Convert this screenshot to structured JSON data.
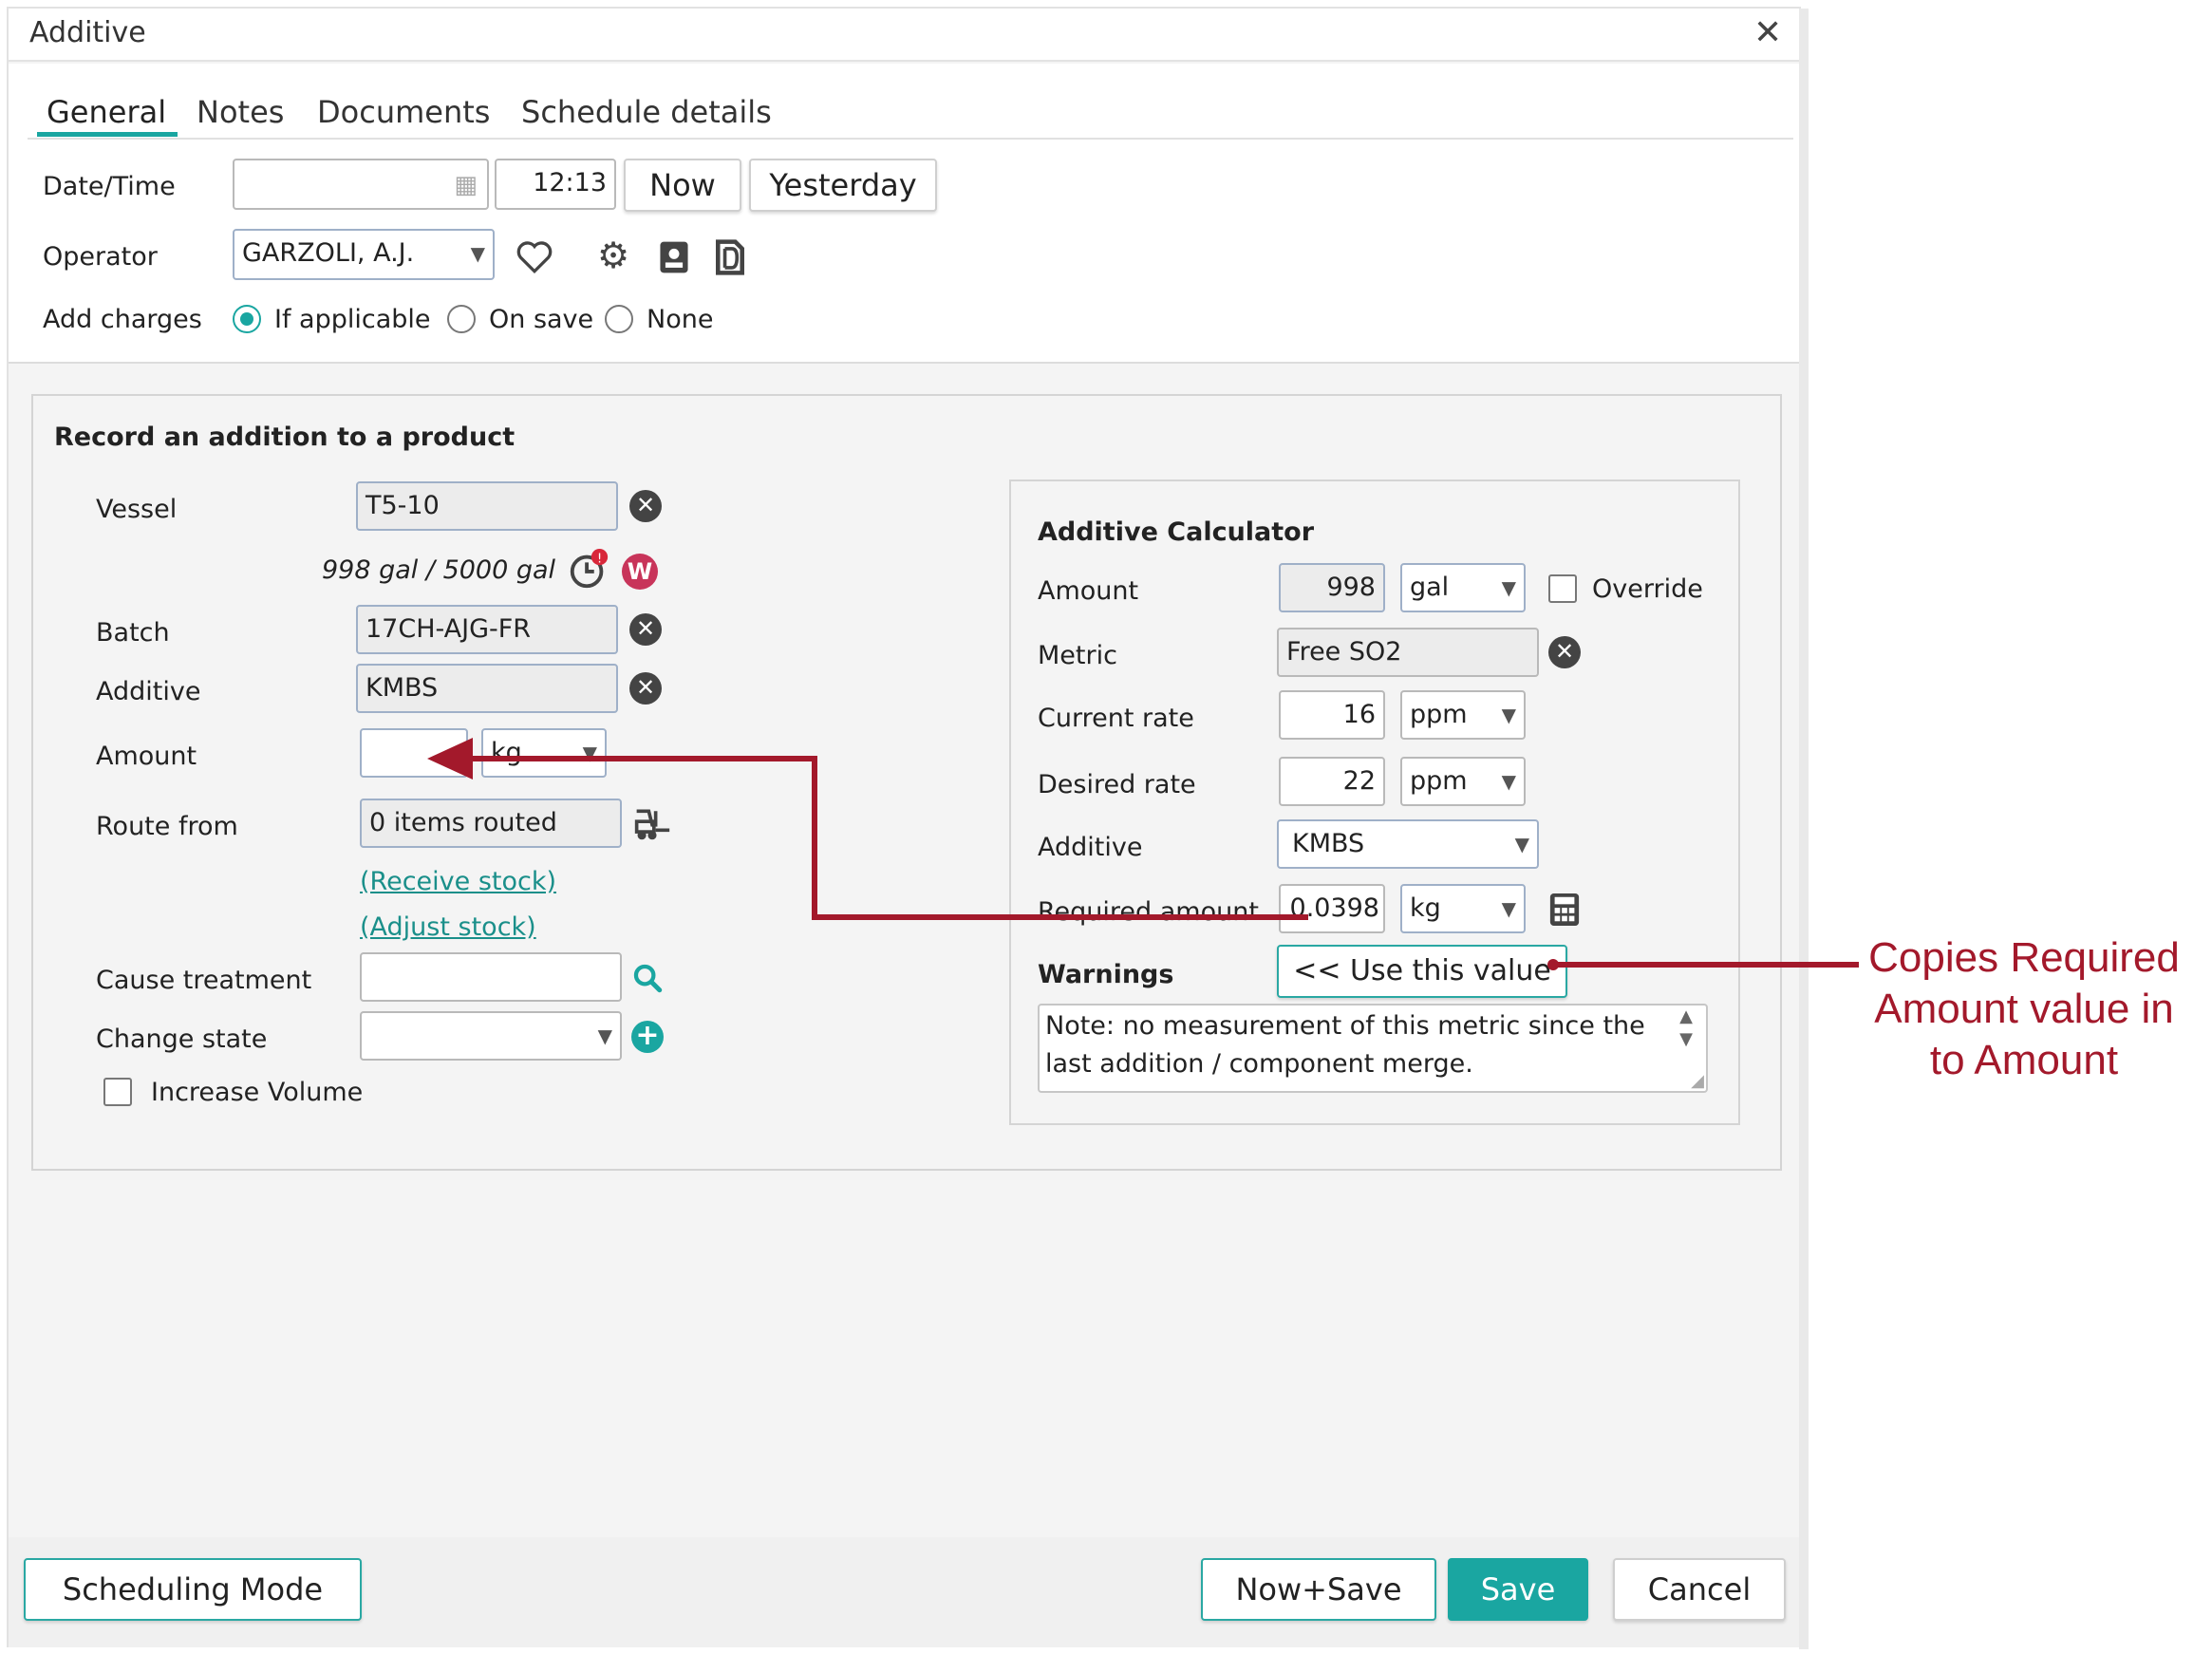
{
  "dialog": {
    "title": "Additive"
  },
  "tabs": [
    {
      "label": "General",
      "active": true
    },
    {
      "label": "Notes"
    },
    {
      "label": "Documents"
    },
    {
      "label": "Schedule details"
    }
  ],
  "datetime": {
    "label": "Date/Time",
    "date_value": "",
    "time_value": "12:13",
    "now_label": "Now",
    "yesterday_label": "Yesterday"
  },
  "operator": {
    "label": "Operator",
    "value": "GARZOLI, A.J."
  },
  "charges": {
    "label": "Add charges",
    "options": [
      "If applicable",
      "On save",
      "None"
    ],
    "selected": "If applicable"
  },
  "record": {
    "heading": "Record an addition to a product",
    "vessel": {
      "label": "Vessel",
      "value": "T5-10",
      "capacity_text": "998 gal / 5000 gal"
    },
    "batch": {
      "label": "Batch",
      "value": "17CH-AJG-FR"
    },
    "additive": {
      "label": "Additive",
      "value": "KMBS"
    },
    "amount": {
      "label": "Amount",
      "value": "",
      "unit": "kg"
    },
    "route": {
      "label": "Route from",
      "value": "0 items routed",
      "receive_link": "(Receive stock)",
      "adjust_link": "(Adjust stock)"
    },
    "cause": {
      "label": "Cause treatment",
      "value": ""
    },
    "state": {
      "label": "Change state",
      "value": ""
    },
    "increase_volume": {
      "label": "Increase Volume",
      "checked": false
    }
  },
  "calculator": {
    "heading": "Additive Calculator",
    "amount": {
      "label": "Amount",
      "value": "998",
      "unit": "gal",
      "override_label": "Override"
    },
    "metric": {
      "label": "Metric",
      "value": "Free SO2"
    },
    "current_rate": {
      "label": "Current rate",
      "value": "16",
      "unit": "ppm"
    },
    "desired_rate": {
      "label": "Desired rate",
      "value": "22",
      "unit": "ppm"
    },
    "additive": {
      "label": "Additive",
      "value": "KMBS"
    },
    "required": {
      "label": "Required amount",
      "value": "0.0398",
      "unit": "kg"
    },
    "warnings": {
      "label": "Warnings",
      "use_value_label": "<< Use this value",
      "note": "Note: no measurement of this metric since the last addition / component merge."
    }
  },
  "footer": {
    "scheduling_label": "Scheduling Mode",
    "now_save_label": "Now+Save",
    "save_label": "Save",
    "cancel_label": "Cancel"
  },
  "annotation": {
    "line1": "Copies Required",
    "line2": "Amount value in",
    "line3": "to Amount",
    "color": "#a3192b"
  },
  "colors": {
    "accent": "#1aa6a1",
    "save_bg": "#1aa6a1",
    "badge_red": "#c8345a"
  },
  "icons": [
    "calendar-icon",
    "heart-icon",
    "gear-icon",
    "contact-card-icon",
    "document-icon",
    "clear-icon",
    "clock-alert-icon",
    "w-badge-icon",
    "forklift-icon",
    "search-icon",
    "add-circle-icon",
    "calculator-icon",
    "close-icon"
  ]
}
